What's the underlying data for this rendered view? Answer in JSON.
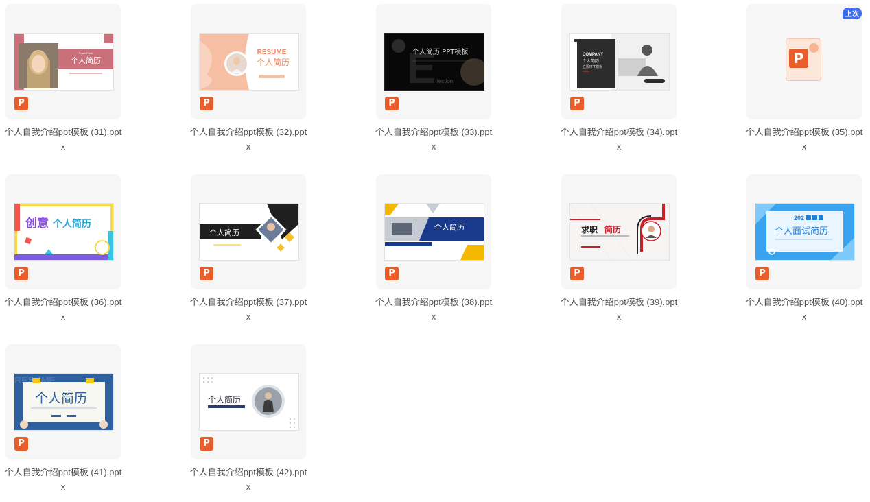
{
  "files": [
    {
      "name": "个人自我介绍ppt模板 (31).pptx",
      "thumb_text": [
        "个人简历",
        "PowerPoint"
      ]
    },
    {
      "name": "个人自我介绍ppt模板 (32).pptx",
      "thumb_text": [
        "RESUME",
        "个人简历"
      ]
    },
    {
      "name": "个人自我介绍ppt模板 (33).pptx",
      "thumb_text": [
        "个人简历 PPT模板",
        "lection"
      ]
    },
    {
      "name": "个人自我介绍ppt模板 (34).pptx",
      "thumb_text": [
        "COMPANY",
        "个人简历",
        "立即PPT模板"
      ]
    },
    {
      "name": "个人自我介绍ppt模板 (35).pptx",
      "badge": "上次"
    },
    {
      "name": "个人自我介绍ppt模板 (36).pptx",
      "thumb_text": [
        "创意",
        "个人简历"
      ]
    },
    {
      "name": "个人自我介绍ppt模板 (37).pptx",
      "thumb_text": [
        "个人简历"
      ]
    },
    {
      "name": "个人自我介绍ppt模板 (38).pptx",
      "thumb_text": [
        "个人简历"
      ]
    },
    {
      "name": "个人自我介绍ppt模板 (39).pptx",
      "thumb_text": [
        "求职",
        "简历"
      ]
    },
    {
      "name": "个人自我介绍ppt模板 (40).pptx",
      "thumb_text": [
        "202",
        "个人面试简历"
      ]
    },
    {
      "name": "个人自我介绍ppt模板 (41).pptx",
      "thumb_text": [
        "RESUME",
        "个人简历"
      ]
    },
    {
      "name": "个人自我介绍ppt模板 (42).pptx",
      "thumb_text": [
        "个人简历"
      ]
    }
  ],
  "file_type_icon": "powerpoint-icon",
  "file_type_letter": "P",
  "colors": {
    "ppt_orange": "#e85d2a",
    "badge_blue": "#3d6df0",
    "card_bg": "#f6f6f7"
  }
}
